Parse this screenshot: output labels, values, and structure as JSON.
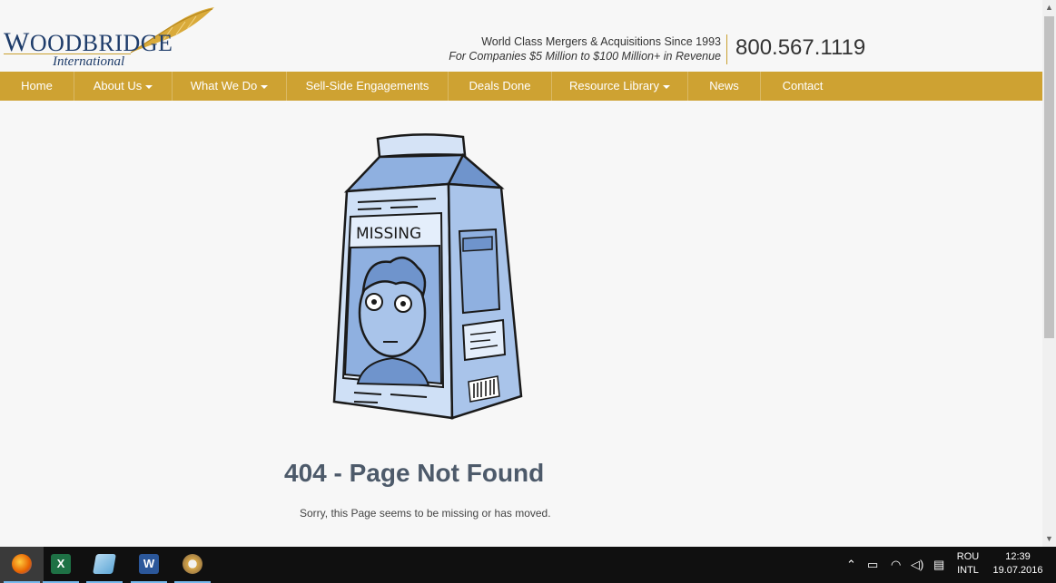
{
  "header": {
    "logo_main_first": "W",
    "logo_main_rest": "OODBRIDGE",
    "logo_sub": "International",
    "tagline_1": "World Class Mergers & Acquisitions Since 1993",
    "tagline_2": "For Companies $5 Million to $100 Million+ in Revenue",
    "phone": "800.567.1119"
  },
  "nav": {
    "items": [
      {
        "label": "Home",
        "dropdown": false
      },
      {
        "label": "About Us",
        "dropdown": true
      },
      {
        "label": "What We Do",
        "dropdown": true
      },
      {
        "label": "Sell-Side Engagements",
        "dropdown": false
      },
      {
        "label": "Deals Done",
        "dropdown": false
      },
      {
        "label": "Resource Library",
        "dropdown": true
      },
      {
        "label": "News",
        "dropdown": false
      },
      {
        "label": "Contact",
        "dropdown": false
      }
    ]
  },
  "main": {
    "illustration_text": "MISSING",
    "title": "404 - Page Not Found",
    "message": "Sorry, this Page seems to be missing or has moved."
  },
  "taskbar": {
    "apps": [
      {
        "name": "firefox-icon",
        "glyph": "",
        "active": true
      },
      {
        "name": "excel-icon",
        "glyph": "X",
        "active": false
      },
      {
        "name": "notes-icon",
        "glyph": "",
        "active": false
      },
      {
        "name": "word-icon",
        "glyph": "W",
        "active": false
      },
      {
        "name": "paint-icon",
        "glyph": "",
        "active": false
      }
    ],
    "language_1": "ROU",
    "language_2": "INTL",
    "time": "12:39",
    "date": "19.07.2016"
  },
  "colors": {
    "nav_bg": "#cea232",
    "brand_blue": "#1f3d6b",
    "gold": "#c9a030",
    "title_color": "#4d5a6a",
    "carton_blue": "#a9c4ea"
  }
}
